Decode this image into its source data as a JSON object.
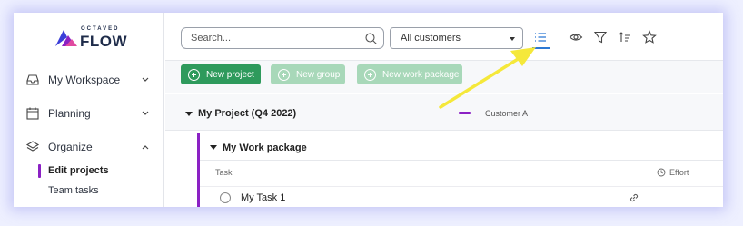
{
  "logo": {
    "top_text": "OCTAVED",
    "main_text": "FLOW"
  },
  "sidebar": {
    "items": [
      {
        "label": "My Workspace",
        "icon": "inbox-icon",
        "chevron": "down"
      },
      {
        "label": "Planning",
        "icon": "calendar-icon",
        "chevron": "down"
      },
      {
        "label": "Organize",
        "icon": "layers-icon",
        "chevron": "up"
      }
    ],
    "subitems": [
      {
        "label": "Edit projects",
        "active": true
      },
      {
        "label": "Team tasks",
        "active": false
      }
    ]
  },
  "toolbar": {
    "search_placeholder": "Search...",
    "customer_filter": "All customers",
    "icons": [
      "list-icon",
      "eye-icon",
      "filter-icon",
      "sort-icon",
      "star-icon"
    ]
  },
  "actions": {
    "new_project": "New project",
    "new_group": "New group",
    "new_work_package": "New work package"
  },
  "project": {
    "title": "My Project (Q4 2022)",
    "customer": "Customer A",
    "customer_color": "#8b21c4"
  },
  "work_package": {
    "title": "My Work package",
    "columns": {
      "task": "Task",
      "effort": "Effort"
    },
    "tasks": [
      {
        "name": "My Task 1"
      }
    ]
  },
  "colors": {
    "accent_green": "#2e9a5c",
    "accent_purple": "#8b21c4",
    "annotation_arrow": "#f5e83a"
  }
}
